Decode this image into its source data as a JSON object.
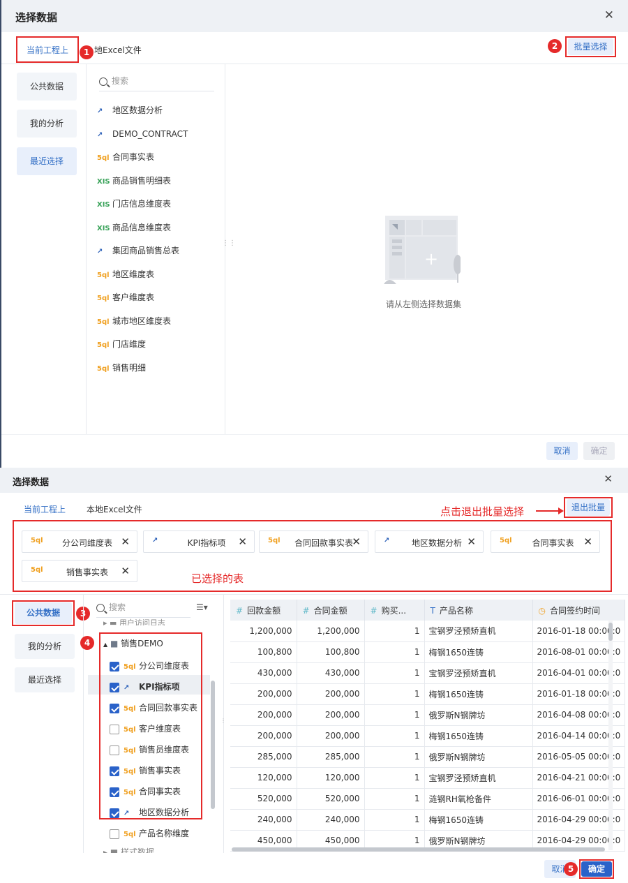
{
  "dialog1": {
    "title": "选择数据",
    "tabs": [
      "当前工程上",
      "本地Excel文件"
    ],
    "batch_button": "批量选择",
    "badges": [
      "1",
      "2"
    ],
    "nav": [
      "公共数据",
      "我的分析",
      "最近选择"
    ],
    "search_placeholder": "搜索",
    "items": [
      {
        "icon": "ana",
        "label": "地区数据分析"
      },
      {
        "icon": "ana",
        "label": "DEMO_CONTRACT"
      },
      {
        "icon": "sql",
        "label": "合同事实表"
      },
      {
        "icon": "xls",
        "label": "商品销售明细表"
      },
      {
        "icon": "xls",
        "label": "门店信息维度表"
      },
      {
        "icon": "xls",
        "label": "商品信息维度表"
      },
      {
        "icon": "ana",
        "label": "集团商品销售总表"
      },
      {
        "icon": "sql",
        "label": "地区维度表"
      },
      {
        "icon": "sql",
        "label": "客户维度表"
      },
      {
        "icon": "sql",
        "label": "城市地区维度表"
      },
      {
        "icon": "sql",
        "label": "门店维度"
      },
      {
        "icon": "sql",
        "label": "销售明细"
      }
    ],
    "empty_text": "请从左侧选择数据集",
    "cancel": "取消",
    "ok": "确定"
  },
  "dialog2": {
    "title": "选择数据",
    "tabs": [
      "当前工程上",
      "本地Excel文件"
    ],
    "exit_batch": "退出批量",
    "exit_hint": "点击退出批量选择",
    "selected_label": "已选择的表",
    "chips": [
      {
        "icon": "sql",
        "label": "分公司维度表"
      },
      {
        "icon": "ana",
        "label": "KPI指标项"
      },
      {
        "icon": "sql",
        "label": "合同回款事实表"
      },
      {
        "icon": "ana",
        "label": "地区数据分析"
      },
      {
        "icon": "sql",
        "label": "合同事实表"
      },
      {
        "icon": "sql",
        "label": "销售事实表"
      }
    ],
    "badges": [
      "3",
      "4",
      "5"
    ],
    "nav": [
      "公共数据",
      "我的分析",
      "最近选择"
    ],
    "search_placeholder": "搜索",
    "tree_folder": "销售DEMO",
    "tree_top_partial": "用户访问日志",
    "tree_bottom_partial": "样式数据",
    "tree": [
      {
        "icon": "sql",
        "label": "分公司维度表",
        "checked": true
      },
      {
        "icon": "ana",
        "label": "KPI指标项",
        "checked": true
      },
      {
        "icon": "sql",
        "label": "合同回款事实表",
        "checked": true
      },
      {
        "icon": "sql",
        "label": "客户维度表",
        "checked": false
      },
      {
        "icon": "sql",
        "label": "销售员维度表",
        "checked": false
      },
      {
        "icon": "sql",
        "label": "销售事实表",
        "checked": true
      },
      {
        "icon": "sql",
        "label": "合同事实表",
        "checked": true
      },
      {
        "icon": "ana",
        "label": "地区数据分析",
        "checked": true
      },
      {
        "icon": "sql",
        "label": "产品名称维度",
        "checked": false
      }
    ],
    "columns": [
      "回款金额",
      "合同金额",
      "购买...",
      "产品名称",
      "合同签约时间"
    ],
    "rows": [
      [
        "1,200,000",
        "1,200,000",
        "1",
        "宝钢罗泾预矫直机",
        "2016-01-18 00:00:0"
      ],
      [
        "100,800",
        "100,800",
        "1",
        "梅钢1650连铸",
        "2016-08-01 00:00:0"
      ],
      [
        "430,000",
        "430,000",
        "1",
        "宝钢罗泾预矫直机",
        "2016-04-01 00:00:0"
      ],
      [
        "200,000",
        "200,000",
        "1",
        "梅钢1650连铸",
        "2016-01-18 00:00:0"
      ],
      [
        "200,000",
        "200,000",
        "1",
        "俄罗斯N钢牌坊",
        "2016-04-08 00:00:0"
      ],
      [
        "200,000",
        "200,000",
        "1",
        "梅钢1650连铸",
        "2016-04-14 00:00:0"
      ],
      [
        "285,000",
        "285,000",
        "1",
        "俄罗斯N钢牌坊",
        "2016-05-05 00:00:0"
      ],
      [
        "120,000",
        "120,000",
        "1",
        "宝钢罗泾预矫直机",
        "2016-04-21 00:00:0"
      ],
      [
        "520,000",
        "520,000",
        "1",
        "涟钢RH氧枪备件",
        "2016-06-01 00:00:0"
      ],
      [
        "240,000",
        "240,000",
        "1",
        "梅钢1650连铸",
        "2016-04-29 00:00:0"
      ],
      [
        "450,000",
        "450,000",
        "1",
        "俄罗斯N钢牌坊",
        "2016-04-29 00:00:0"
      ]
    ],
    "cancel": "取消",
    "ok": "确定"
  },
  "colors": {
    "accent": "#2a62c9",
    "annotation": "#e52a2a",
    "sql_icon": "#f0a020",
    "xls_icon": "#3aa35a",
    "analysis_icon": "#2a5fb8"
  }
}
